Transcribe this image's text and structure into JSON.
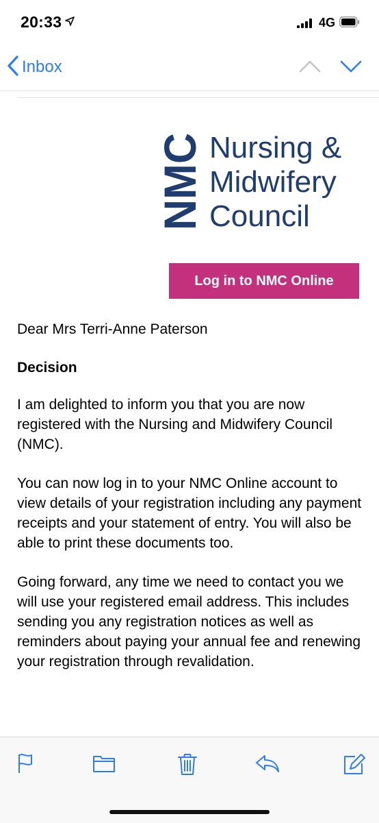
{
  "status_bar": {
    "time": "20:33",
    "network": "4G",
    "icons": [
      "location-arrow-icon",
      "signal-bars-icon",
      "battery-icon"
    ]
  },
  "nav": {
    "back_label": "Inbox",
    "icons": [
      "chevron-left-icon",
      "chevron-up-icon",
      "chevron-down-icon"
    ],
    "accent_color": "#2f7bf6"
  },
  "email": {
    "logo": {
      "abbreviation": "NMC",
      "lines": [
        "Nursing &",
        "Midwifery",
        "Council"
      ],
      "color": "#1f3d6e"
    },
    "login_button_label": "Log in to NMC Online",
    "login_button_color": "#c3317d",
    "greeting": "Dear Mrs Terri-Anne Paterson",
    "heading": "Decision",
    "paragraphs": [
      "I am delighted to inform you that you are now registered with the Nursing and Midwifery Council (NMC).",
      "You can now log in to your NMC Online account to view details of your registration including any payment receipts and your statement of entry. You will also be able to print these documents too.",
      "Going forward, any time we need to contact you we will use your registered email address. This includes sending you any registration notices as well as reminders about paying your annual fee and renewing your registration through revalidation."
    ]
  },
  "toolbar": {
    "icons": [
      "flag-icon",
      "folder-icon",
      "trash-icon",
      "reply-icon",
      "compose-icon"
    ]
  }
}
